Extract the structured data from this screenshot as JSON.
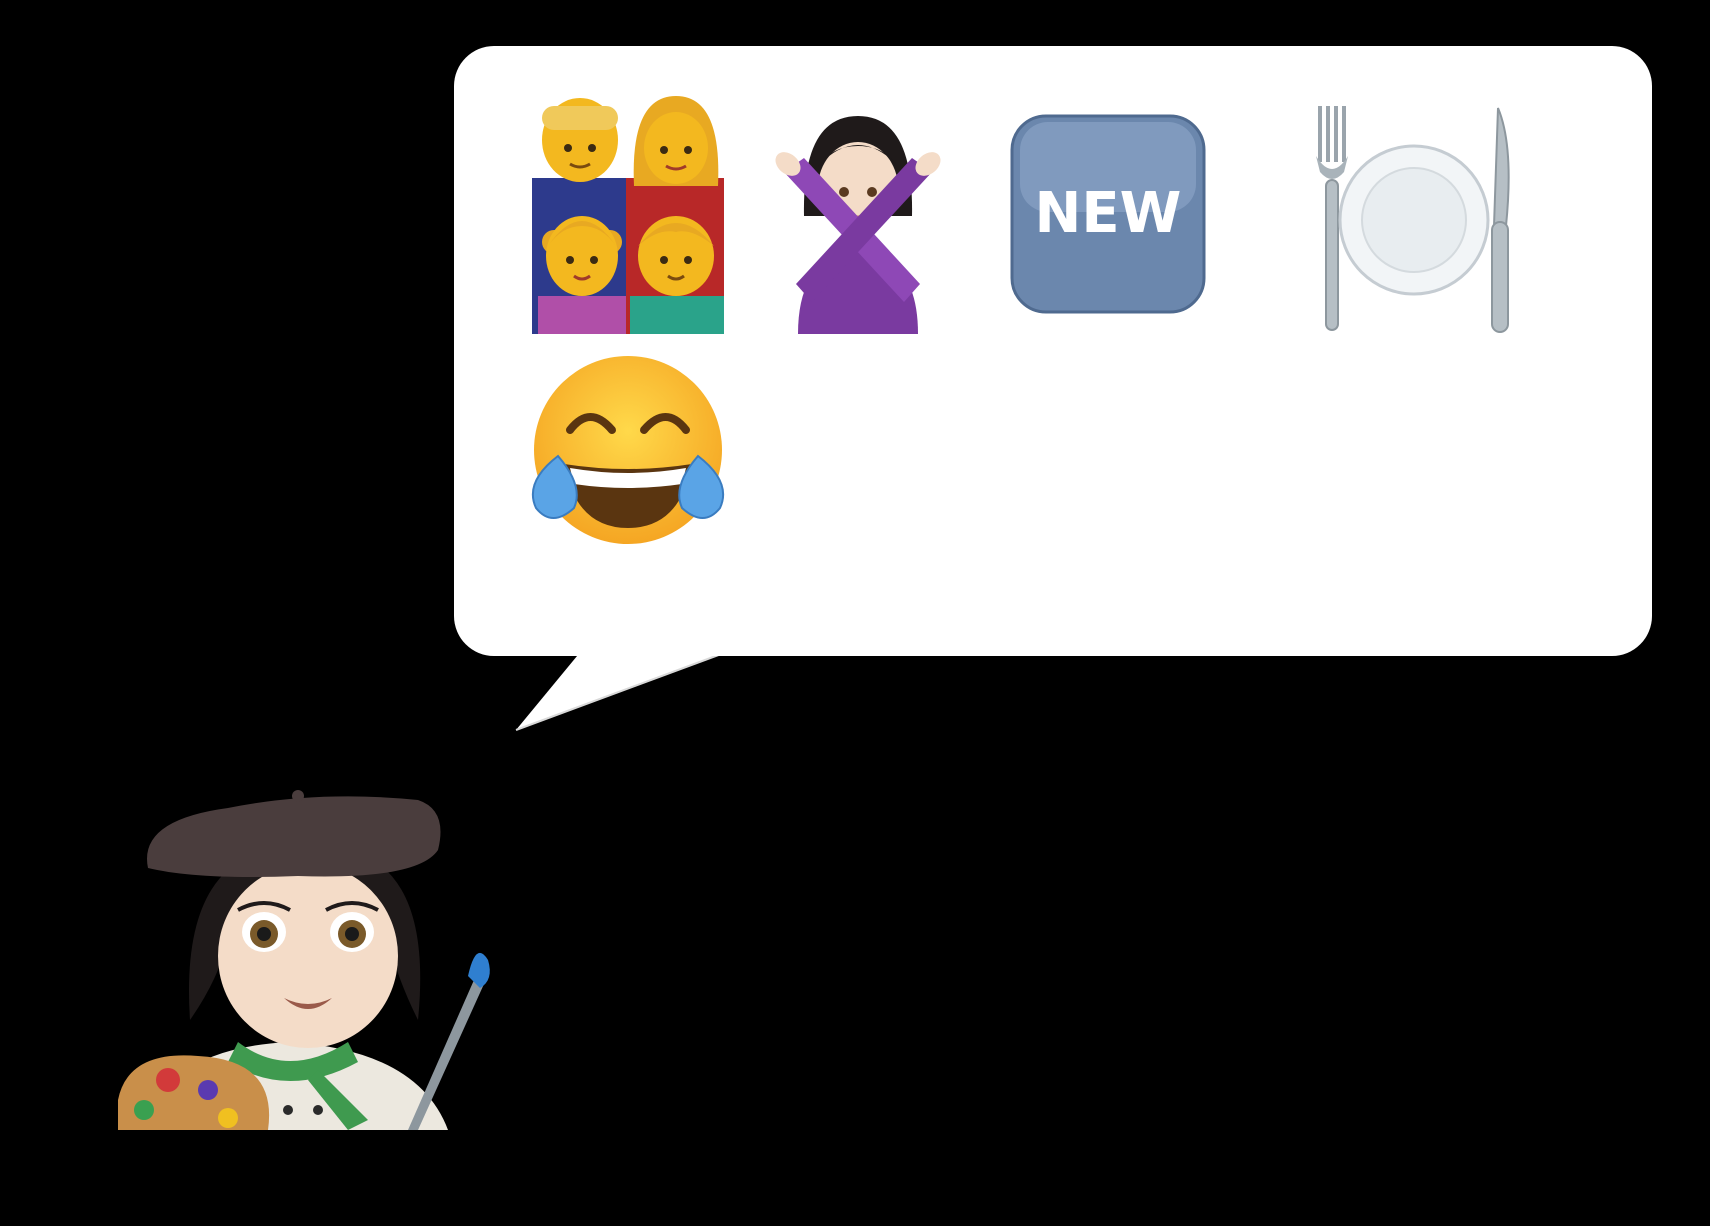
{
  "bubble": {
    "emojis": [
      {
        "name": "family",
        "icon": "family-emoji"
      },
      {
        "name": "no-gesture",
        "icon": "woman-gesturing-no-emoji"
      },
      {
        "name": "new",
        "icon": "new-button-emoji",
        "text": "NEW"
      },
      {
        "name": "fork-knife-plate",
        "icon": "fork-and-knife-with-plate-emoji"
      },
      {
        "name": "tears-of-joy",
        "icon": "face-with-tears-of-joy-emoji"
      }
    ]
  },
  "speaker": {
    "icon": "woman-artist-emoji"
  },
  "colors": {
    "background": "#000000",
    "bubble": "#ffffff",
    "new_badge": "#6f8db3",
    "beret": "#4a3d3d",
    "scarf": "#3f9a4f"
  }
}
